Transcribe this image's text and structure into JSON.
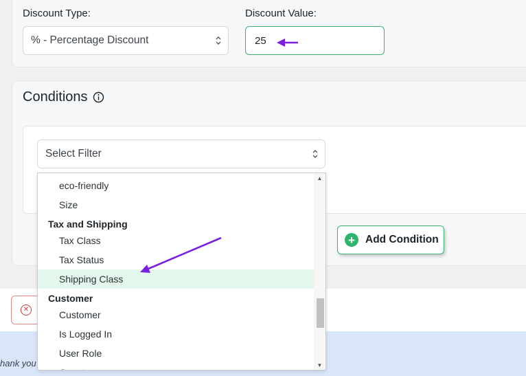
{
  "discount": {
    "type_label": "Discount Type:",
    "type_value": "% - Percentage Discount",
    "value_label": "Discount Value:",
    "value": "25"
  },
  "conditions": {
    "title": "Conditions",
    "filter_placeholder": "Select Filter",
    "add_condition_label": "Add Condition"
  },
  "dropdown": {
    "items": [
      {
        "kind": "option",
        "label": "eco-friendly"
      },
      {
        "kind": "option",
        "label": "Size"
      },
      {
        "kind": "group",
        "label": "Tax and Shipping"
      },
      {
        "kind": "option",
        "label": "Tax Class"
      },
      {
        "kind": "option",
        "label": "Tax Status"
      },
      {
        "kind": "option",
        "label": "Shipping Class",
        "highlighted": true
      },
      {
        "kind": "group",
        "label": "Customer"
      },
      {
        "kind": "option",
        "label": "Customer"
      },
      {
        "kind": "option",
        "label": "Is Logged In"
      },
      {
        "kind": "option",
        "label": "User Role"
      },
      {
        "kind": "option",
        "label": "Country"
      }
    ]
  },
  "footer": {
    "text": "hank you"
  },
  "icons": {
    "info": "info-circle-icon",
    "plus": "plus-circle-icon",
    "cancel": "x-circle-icon",
    "select_arrows": "chevron-updown-icon",
    "annotation": "arrow-annotation-icon"
  },
  "colors": {
    "accent_green": "#2fb56b",
    "annotation_purple": "#7b1fe0",
    "highlight_row": "#e4f7ec",
    "footer_blue": "#d9e6fa",
    "danger_red": "#d63638"
  }
}
